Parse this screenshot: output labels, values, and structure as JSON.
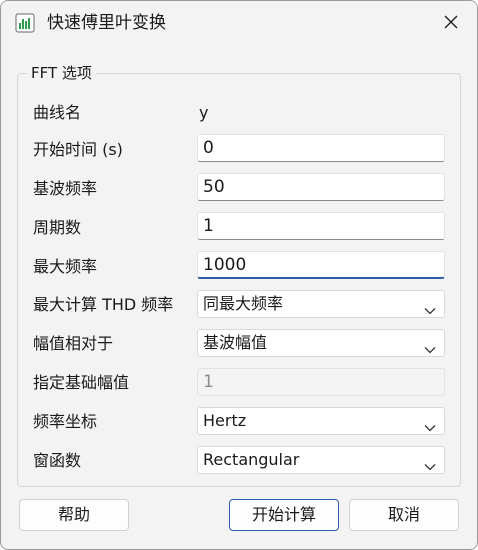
{
  "window": {
    "title": "快速傅里叶变换",
    "app_icon": "bar-chart-icon",
    "close_icon": "close-icon"
  },
  "group": {
    "title": "FFT 选项"
  },
  "fields": {
    "curve_name": {
      "label": "曲线名",
      "value": "y"
    },
    "start_time": {
      "label": "开始时间 (s)",
      "value": "0"
    },
    "fundamental_freq": {
      "label": "基波频率",
      "value": "50"
    },
    "periods": {
      "label": "周期数",
      "value": "1"
    },
    "max_freq": {
      "label": "最大频率",
      "value": "1000"
    },
    "max_thd_freq": {
      "label": "最大计算 THD 频率",
      "value": "同最大频率"
    },
    "amplitude_relative": {
      "label": "幅值相对于",
      "value": "基波幅值"
    },
    "base_amplitude": {
      "label": "指定基础幅值",
      "value": "1"
    },
    "freq_axis": {
      "label": "频率坐标",
      "value": "Hertz"
    },
    "window_function": {
      "label": "窗函数",
      "value": "Rectangular"
    }
  },
  "buttons": {
    "help": "帮助",
    "start": "开始计算",
    "cancel": "取消"
  },
  "colors": {
    "accent": "#2b5ea7",
    "icon_green": "#2e9c4f"
  }
}
